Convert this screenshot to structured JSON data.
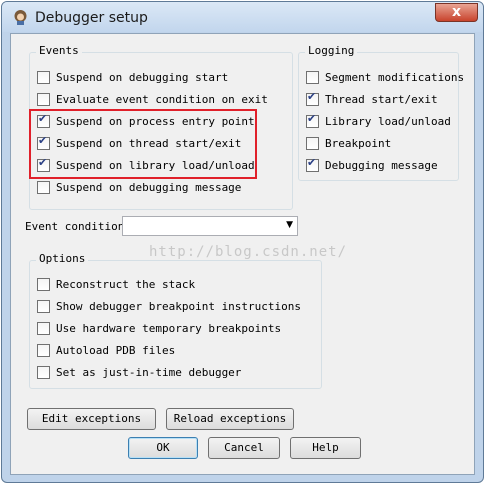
{
  "window": {
    "title": "Debugger setup",
    "close_label": "x"
  },
  "events": {
    "legend": "Events",
    "items": [
      {
        "label": "Suspend on debugging start",
        "checked": false
      },
      {
        "label": "Evaluate event condition on exit",
        "checked": false
      },
      {
        "label": "Suspend on process entry point",
        "checked": true
      },
      {
        "label": "Suspend on thread start/exit",
        "checked": true
      },
      {
        "label": "Suspend on library load/unload",
        "checked": true
      },
      {
        "label": "Suspend on debugging message",
        "checked": false
      }
    ]
  },
  "logging": {
    "legend": "Logging",
    "items": [
      {
        "label": "Segment modifications",
        "checked": false
      },
      {
        "label": "Thread start/exit",
        "checked": true
      },
      {
        "label": "Library load/unload",
        "checked": true
      },
      {
        "label": "Breakpoint",
        "checked": false
      },
      {
        "label": "Debugging message",
        "checked": true
      }
    ]
  },
  "event_condition": {
    "label": "Event condition",
    "value": ""
  },
  "watermark": "http://blog.csdn.net/",
  "options": {
    "legend": "Options",
    "items": [
      {
        "label": "Reconstruct the stack",
        "checked": false
      },
      {
        "label": "Show debugger breakpoint instructions",
        "checked": false
      },
      {
        "label": "Use hardware temporary breakpoints",
        "checked": false
      },
      {
        "label": "Autoload PDB files",
        "checked": false
      },
      {
        "label": "Set as just-in-time debugger",
        "checked": false
      }
    ]
  },
  "buttons": {
    "edit_exceptions": "Edit exceptions",
    "reload_exceptions": "Reload exceptions",
    "ok": "OK",
    "cancel": "Cancel",
    "help": "Help"
  },
  "colors": {
    "highlight": "#e0202a",
    "check": "#2a3f84",
    "close": "#c8432c"
  },
  "icons": {
    "app": "debugger-app-icon",
    "close": "close-icon",
    "dropdown": "chevron-down-icon"
  }
}
